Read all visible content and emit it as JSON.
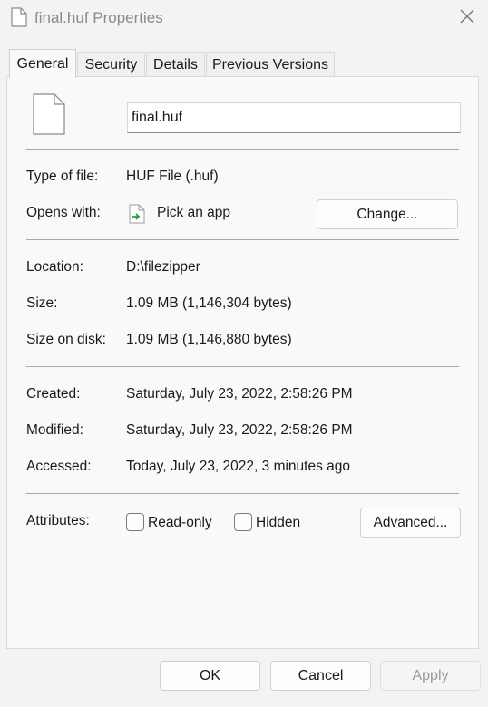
{
  "window": {
    "title": "final.huf Properties",
    "title_icon": "document-icon",
    "close_icon": "close-icon"
  },
  "tabs": [
    {
      "label": "General",
      "active": true
    },
    {
      "label": "Security",
      "active": false
    },
    {
      "label": "Details",
      "active": false
    },
    {
      "label": "Previous Versions",
      "active": false
    }
  ],
  "general": {
    "file_name": "final.huf",
    "type_label": "Type of file:",
    "type_value": "HUF File (.huf)",
    "opens_label": "Opens with:",
    "opens_value": "Pick an app",
    "opens_icon": "pick-app-icon",
    "change_label": "Change...",
    "location_label": "Location:",
    "location_value": "D:\\filezipper",
    "size_label": "Size:",
    "size_value": "1.09 MB (1,146,304 bytes)",
    "size_disk_label": "Size on disk:",
    "size_disk_value": "1.09 MB (1,146,880 bytes)",
    "created_label": "Created:",
    "created_value": "Saturday, July 23, 2022, 2:58:26 PM",
    "modified_label": "Modified:",
    "modified_value": "Saturday, July 23, 2022, 2:58:26 PM",
    "accessed_label": "Accessed:",
    "accessed_value": "Today, July 23, 2022, 3 minutes ago",
    "attributes_label": "Attributes:",
    "readonly_label": "Read-only",
    "readonly_checked": false,
    "hidden_label": "Hidden",
    "hidden_checked": false,
    "advanced_label": "Advanced..."
  },
  "footer": {
    "ok_label": "OK",
    "cancel_label": "Cancel",
    "apply_label": "Apply",
    "apply_disabled": true
  },
  "colors": {
    "background": "#f3f3f3",
    "panel": "#f9f9f9",
    "accent_green": "#2e9a3a"
  }
}
